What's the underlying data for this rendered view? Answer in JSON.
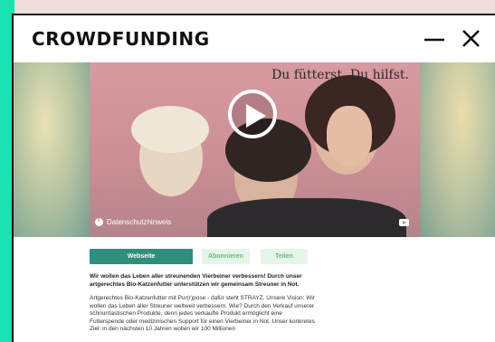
{
  "window": {
    "title": "CROWDFUNDING"
  },
  "video": {
    "caption": "Du fütterst. Du hilfst.",
    "privacy_label": "Datenschutzhinweis"
  },
  "actions": {
    "website_label": "Webseite",
    "subscribe_label": "Abonnieren",
    "share_label": "Teilen"
  },
  "article": {
    "lead": "Wir wollen das Leben aller streunenden Vierbeiner verbessern! Durch unser artgerechtes Bio-Katzenfutter unterstützen wir gemeinsam Streuner in Not.",
    "body": "Artgerechtes Bio-Katzenfutter mit Pur(r)pose - dafür steht STRAYZ. Unsere Vision: Wir wollen das Leben aller Streuner weltweit verbessern. Wie? Durch den Verkauf unserer schnurrtastischen Produkte, denn jedes verkaufte Produkt ermöglicht eine Futterspende oder medizinischen Support für einen Vierbeiner in Not. Unser konkretes Ziel: in den nächsten 10 Jahren wollen wir 100 Millionen"
  },
  "colors": {
    "accent": "#19e3b2",
    "primary_button": "#2e8f7c",
    "secondary_button_text": "#5fbf79"
  }
}
